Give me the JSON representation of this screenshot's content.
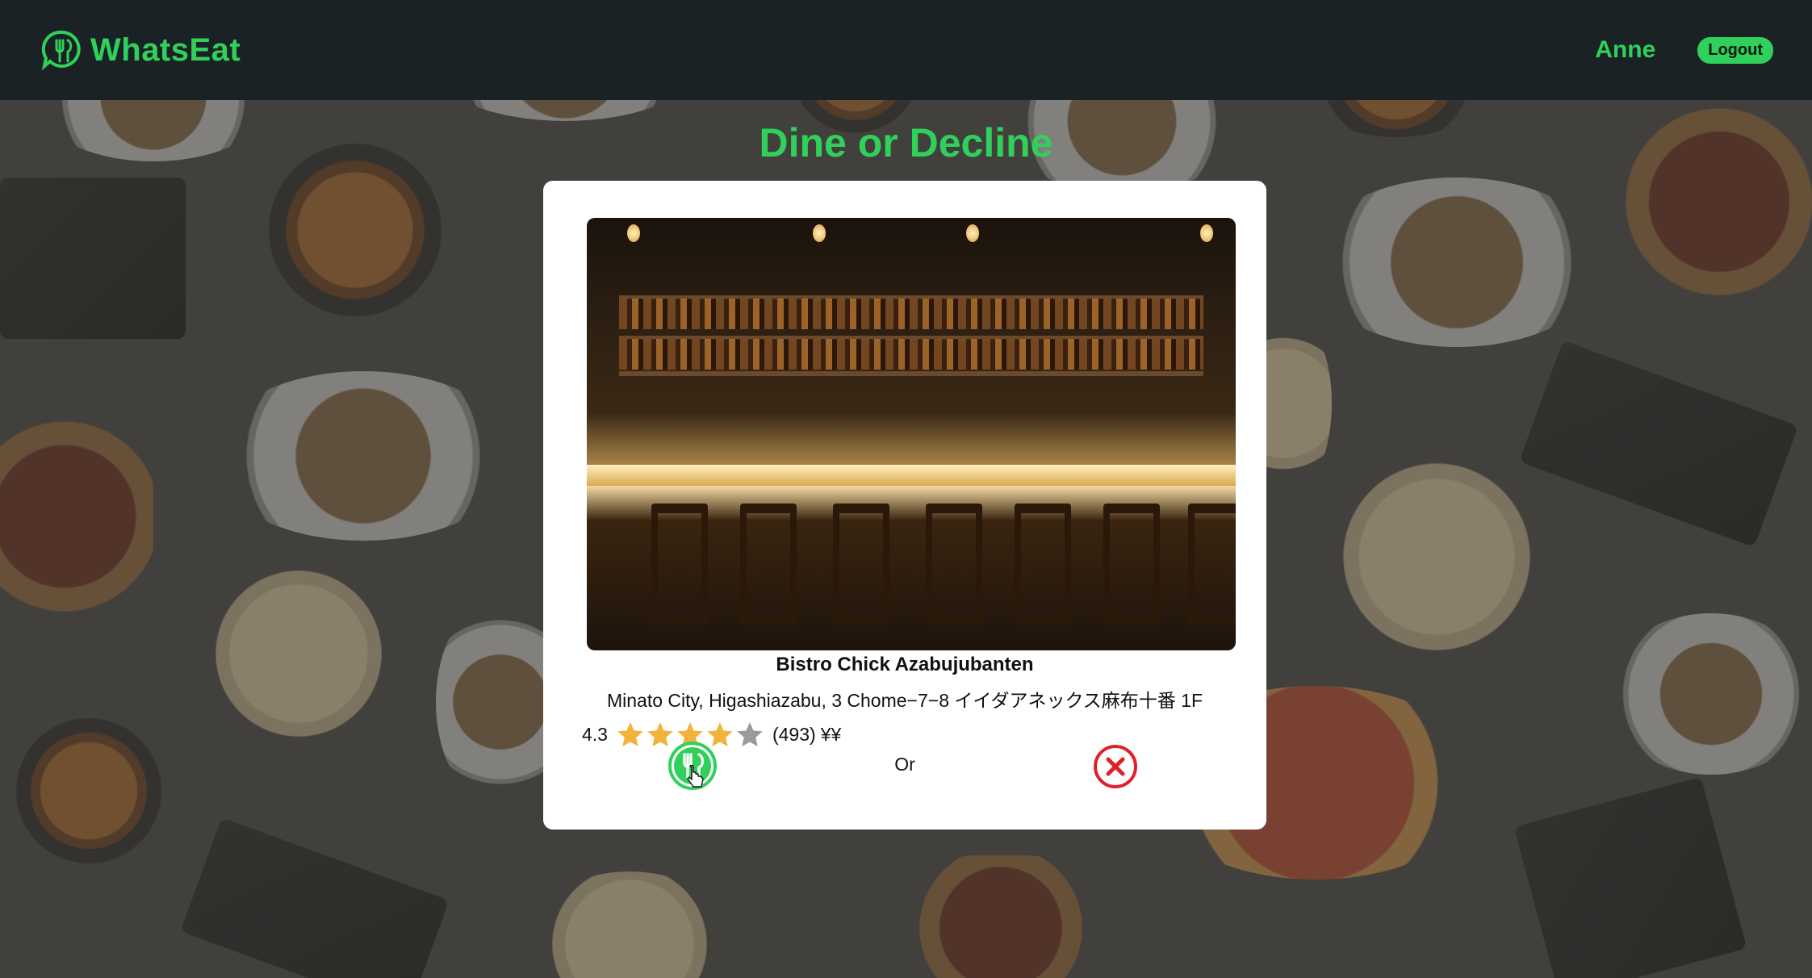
{
  "header": {
    "brand_name": "WhatsEat",
    "brand_icon": "chat-utensils-icon",
    "username": "Anne",
    "logout_label": "Logout"
  },
  "page": {
    "title": "Dine or Decline"
  },
  "restaurant": {
    "name": "Bistro Chick Azabujubanten",
    "address": "Minato City, Higashiazabu, 3 Chome−7−8 イイダアネックス麻布十番 1F",
    "rating": "4.3",
    "rating_value": 4.3,
    "rating_max": 5,
    "review_count": "(493)",
    "price_level": "¥¥"
  },
  "actions": {
    "or_label": "Or",
    "dine_icon": "utensils-icon",
    "decline_icon": "close-icon"
  },
  "colors": {
    "accent": "#2fd15a",
    "header_bg": "#1b2226",
    "decline": "#e0202a",
    "star_filled": "#f2b33d",
    "star_empty": "#9a9a9a"
  }
}
